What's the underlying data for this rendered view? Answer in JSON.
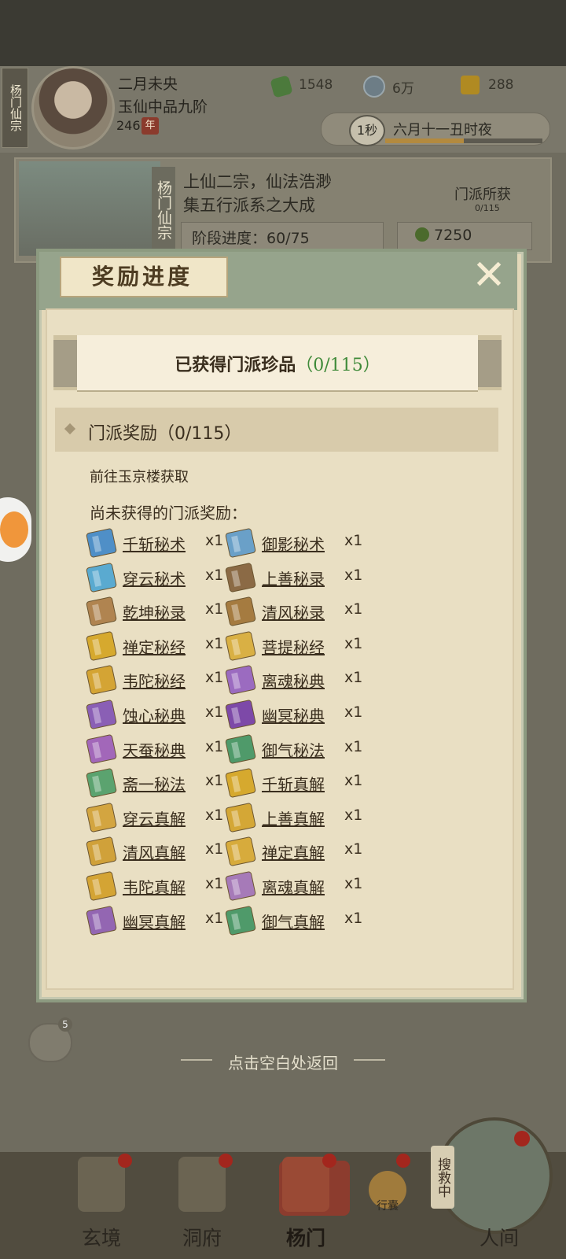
{
  "header": {
    "sect_tag": "杨门仙宗",
    "player_name": "二月未央",
    "player_rank": "玉仙中品九阶",
    "player_age": "246",
    "age_unit": "年",
    "resources": [
      {
        "icon": "leaf-icon",
        "value": "1548"
      },
      {
        "icon": "coin-icon",
        "value": "6万"
      },
      {
        "icon": "gold-ingot-icon",
        "value": "288"
      }
    ],
    "time_speed": "1秒",
    "time_text": "六月十一丑时夜",
    "time_progress": 0.5
  },
  "sect": {
    "vertical_name": "杨门仙宗",
    "motto_line1": "上仙二宗，仙法浩渺",
    "motto_line2": "集五行派系之大成",
    "loot_label": "门派所获",
    "loot_count": "0/115",
    "stage_progress": "阶段进度：60/75",
    "coins": "7250"
  },
  "popup": {
    "title": "奖励进度",
    "close_icon": "close-icon",
    "treasure_label": "已获得门派珍品",
    "treasure_count": "（0/115）",
    "section_title": "门派奖励（0/115）",
    "goto_text": "前往玉京楼获取",
    "missing_title": "尚未获得的门派奖励：",
    "rewards": [
      {
        "name": "千斩秘术",
        "qty": "x1",
        "color": "#4f8fc7"
      },
      {
        "name": "御影秘术",
        "qty": "x1",
        "color": "#6aa0c8"
      },
      {
        "name": "穿云秘术",
        "qty": "x1",
        "color": "#5aaad0"
      },
      {
        "name": "上善秘录",
        "qty": "x1",
        "color": "#8b6a45"
      },
      {
        "name": "乾坤秘录",
        "qty": "x1",
        "color": "#b08450"
      },
      {
        "name": "清风秘录",
        "qty": "x1",
        "color": "#a57b40"
      },
      {
        "name": "禅定秘经",
        "qty": "x1",
        "color": "#d6a92e"
      },
      {
        "name": "菩提秘经",
        "qty": "x1",
        "color": "#d9b044"
      },
      {
        "name": "韦陀秘经",
        "qty": "x1",
        "color": "#d4a434"
      },
      {
        "name": "离魂秘典",
        "qty": "x1",
        "color": "#9b6bc0"
      },
      {
        "name": "蚀心秘典",
        "qty": "x1",
        "color": "#8a5fb5"
      },
      {
        "name": "幽冥秘典",
        "qty": "x1",
        "color": "#7d49a8"
      },
      {
        "name": "天蚕秘典",
        "qty": "x1",
        "color": "#a267b9"
      },
      {
        "name": "御气秘法",
        "qty": "x1",
        "color": "#4f9a6a"
      },
      {
        "name": "斋一秘法",
        "qty": "x1",
        "color": "#5ba36f"
      },
      {
        "name": "千斩真解",
        "qty": "x1",
        "color": "#d6a92e"
      },
      {
        "name": "穿云真解",
        "qty": "x1",
        "color": "#d3a540"
      },
      {
        "name": "上善真解",
        "qty": "x1",
        "color": "#d4a736"
      },
      {
        "name": "清风真解",
        "qty": "x1",
        "color": "#d0a13a"
      },
      {
        "name": "禅定真解",
        "qty": "x1",
        "color": "#d7ab3c"
      },
      {
        "name": "韦陀真解",
        "qty": "x1",
        "color": "#d4a434"
      },
      {
        "name": "离魂真解",
        "qty": "x1",
        "color": "#a67ab8"
      },
      {
        "name": "幽冥真解",
        "qty": "x1",
        "color": "#9366b2"
      },
      {
        "name": "御气真解",
        "qty": "x1",
        "color": "#4f9a6a"
      }
    ],
    "return_hint": "点击空白处返回"
  },
  "chat": {
    "count": "5"
  },
  "nav": {
    "items": [
      {
        "label": "玄境"
      },
      {
        "label": "洞府"
      },
      {
        "label": "杨门"
      },
      {
        "label": "行囊"
      },
      {
        "label": "人间"
      }
    ],
    "search_tag": "搜救中"
  }
}
